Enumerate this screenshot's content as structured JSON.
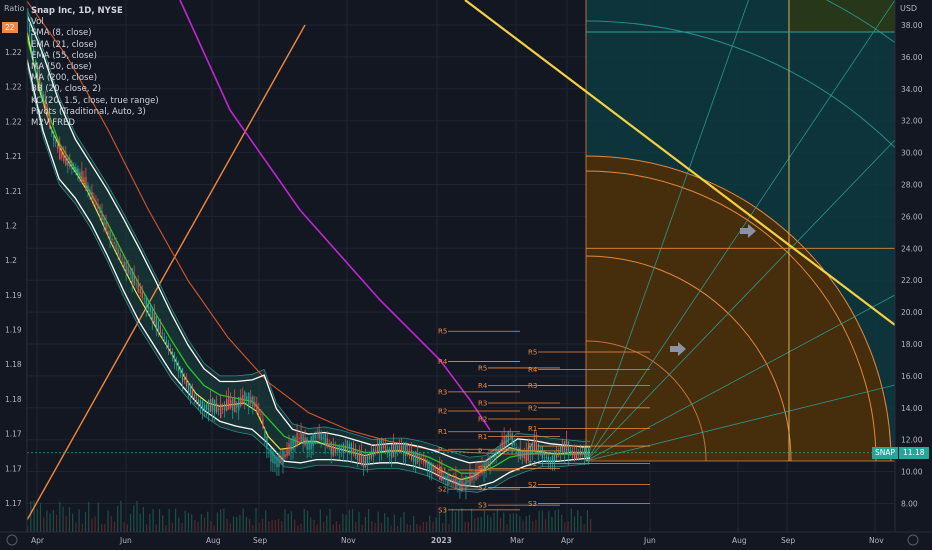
{
  "header": {
    "symbol_line": "Snap Inc, 1D, NYSE",
    "ratio_label": "Ratio",
    "usd_label": "USD",
    "ratio_badge": "22"
  },
  "indicators": [
    "Vol",
    "SMA (8, close)",
    "EMA (21, close)",
    "EMA (55, close)",
    "MA (50, close)",
    "MA (200, close)",
    "BB (20, close, 2)",
    "KC (20, 1.5, close, true range)",
    "Pivots (Traditional, Auto, 3)",
    "M2V FRED"
  ],
  "price_badge": {
    "symbol": "SNAP",
    "value": "11.18",
    "color": "#26a69a"
  },
  "chart_data": {
    "type": "line",
    "x_ticks": [
      "Apr",
      "Jun",
      "Aug",
      "Sep",
      "Nov",
      "2023",
      "Mar",
      "Apr",
      "Jun",
      "Aug",
      "Sep",
      "Nov"
    ],
    "y_right_ticks": [
      "38.00",
      "36.00",
      "34.00",
      "32.00",
      "30.00",
      "28.00",
      "26.00",
      "24.00",
      "22.00",
      "20.00",
      "18.00",
      "16.00",
      "14.00",
      "12.00",
      "10.00",
      "8.00"
    ],
    "y_right_values": [
      38,
      36,
      34,
      32,
      30,
      28,
      26,
      24,
      22,
      20,
      18,
      16,
      14,
      12,
      10,
      8
    ],
    "y_left_ticks": [
      "1.22",
      "1.22",
      "1.22",
      "1.21",
      "1.21",
      "1.2",
      "1.2",
      "1.19",
      "1.19",
      "1.18",
      "1.18",
      "1.17",
      "1.17",
      "1.17"
    ],
    "ylim": [
      6.4,
      39.6
    ],
    "price_path": [
      [
        0,
        38.6
      ],
      [
        4,
        35.5
      ],
      [
        8,
        33.5
      ],
      [
        12,
        31.3
      ],
      [
        16,
        30.0
      ],
      [
        20,
        29.4
      ],
      [
        24,
        29.0
      ],
      [
        28,
        28.3
      ],
      [
        32,
        27.3
      ],
      [
        36,
        26.4
      ],
      [
        40,
        25.0
      ],
      [
        44,
        24.1
      ],
      [
        48,
        23.0
      ],
      [
        52,
        22.3
      ],
      [
        56,
        21.3
      ],
      [
        60,
        20.4
      ],
      [
        64,
        19.4
      ],
      [
        68,
        18.4
      ],
      [
        72,
        17.4
      ],
      [
        76,
        16.3
      ],
      [
        80,
        15.3
      ],
      [
        84,
        14.5
      ],
      [
        88,
        14.0
      ],
      [
        92,
        14.2
      ],
      [
        96,
        13.8
      ],
      [
        100,
        14.3
      ],
      [
        104,
        14.1
      ],
      [
        108,
        14.7
      ],
      [
        112,
        14.4
      ],
      [
        116,
        13.6
      ],
      [
        120,
        11.2
      ],
      [
        124,
        10.6
      ],
      [
        128,
        11.0
      ],
      [
        132,
        11.8
      ],
      [
        136,
        12.2
      ],
      [
        140,
        11.6
      ],
      [
        144,
        12.4
      ],
      [
        148,
        12.0
      ],
      [
        152,
        11.3
      ],
      [
        156,
        11.4
      ],
      [
        160,
        11.6
      ],
      [
        164,
        11.0
      ],
      [
        168,
        10.6
      ],
      [
        172,
        11.2
      ],
      [
        176,
        11.7
      ],
      [
        180,
        11.2
      ],
      [
        184,
        11.5
      ],
      [
        188,
        11.4
      ],
      [
        192,
        10.9
      ],
      [
        196,
        10.8
      ],
      [
        200,
        10.3
      ],
      [
        204,
        10.0
      ],
      [
        208,
        9.6
      ],
      [
        212,
        9.4
      ],
      [
        216,
        9.1
      ],
      [
        220,
        9.5
      ],
      [
        224,
        9.9
      ],
      [
        228,
        10.4
      ],
      [
        232,
        10.9
      ],
      [
        236,
        11.7
      ],
      [
        240,
        12.3
      ],
      [
        244,
        11.2
      ],
      [
        248,
        10.9
      ],
      [
        252,
        11.7
      ],
      [
        256,
        11.2
      ],
      [
        260,
        10.6
      ],
      [
        264,
        11.2
      ],
      [
        268,
        11.6
      ],
      [
        272,
        11.0
      ],
      [
        276,
        11.2
      ],
      [
        280,
        11.18
      ]
    ],
    "ma_fast_path": [
      [
        0,
        37.6
      ],
      [
        6,
        34.0
      ],
      [
        12,
        31.5
      ],
      [
        18,
        29.9
      ],
      [
        24,
        28.8
      ],
      [
        30,
        27.6
      ],
      [
        36,
        26.0
      ],
      [
        42,
        24.3
      ],
      [
        48,
        22.8
      ],
      [
        54,
        21.3
      ],
      [
        60,
        20.0
      ],
      [
        66,
        18.6
      ],
      [
        72,
        17.4
      ],
      [
        78,
        16.0
      ],
      [
        84,
        14.9
      ],
      [
        90,
        14.3
      ],
      [
        96,
        14.1
      ],
      [
        102,
        14.2
      ],
      [
        108,
        14.3
      ],
      [
        114,
        13.8
      ],
      [
        120,
        12.2
      ],
      [
        126,
        11.4
      ],
      [
        132,
        11.5
      ],
      [
        138,
        11.9
      ],
      [
        144,
        11.9
      ],
      [
        150,
        11.6
      ],
      [
        156,
        11.4
      ],
      [
        162,
        11.2
      ],
      [
        168,
        11.0
      ],
      [
        174,
        11.2
      ],
      [
        180,
        11.3
      ],
      [
        186,
        11.3
      ],
      [
        192,
        11.0
      ],
      [
        198,
        10.7
      ],
      [
        204,
        10.2
      ],
      [
        210,
        9.8
      ],
      [
        216,
        9.5
      ],
      [
        222,
        9.7
      ],
      [
        228,
        10.2
      ],
      [
        234,
        10.9
      ],
      [
        240,
        11.5
      ],
      [
        246,
        11.3
      ],
      [
        252,
        11.3
      ],
      [
        258,
        11.2
      ],
      [
        264,
        11.1
      ],
      [
        270,
        11.2
      ],
      [
        276,
        11.2
      ],
      [
        280,
        11.2
      ]
    ],
    "ma_mid_path": [
      [
        0,
        37.2
      ],
      [
        8,
        33.4
      ],
      [
        16,
        30.6
      ],
      [
        24,
        29.0
      ],
      [
        32,
        27.4
      ],
      [
        40,
        25.6
      ],
      [
        48,
        23.6
      ],
      [
        56,
        21.7
      ],
      [
        64,
        19.9
      ],
      [
        72,
        18.2
      ],
      [
        80,
        16.6
      ],
      [
        88,
        15.4
      ],
      [
        96,
        14.8
      ],
      [
        104,
        14.6
      ],
      [
        112,
        14.4
      ],
      [
        120,
        13.3
      ],
      [
        128,
        12.2
      ],
      [
        136,
        11.8
      ],
      [
        144,
        11.8
      ],
      [
        152,
        11.7
      ],
      [
        160,
        11.5
      ],
      [
        168,
        11.2
      ],
      [
        176,
        11.2
      ],
      [
        184,
        11.3
      ],
      [
        192,
        11.2
      ],
      [
        200,
        10.9
      ],
      [
        208,
        10.4
      ],
      [
        216,
        9.9
      ],
      [
        224,
        9.9
      ],
      [
        232,
        10.3
      ],
      [
        240,
        10.9
      ],
      [
        248,
        11.1
      ],
      [
        256,
        11.2
      ],
      [
        264,
        11.1
      ],
      [
        272,
        11.1
      ],
      [
        280,
        11.2
      ]
    ],
    "bb_upper_path": [
      [
        0,
        39.0
      ],
      [
        8,
        36.5
      ],
      [
        16,
        33.5
      ],
      [
        24,
        31.2
      ],
      [
        32,
        29.6
      ],
      [
        40,
        28.0
      ],
      [
        48,
        26.2
      ],
      [
        56,
        24.3
      ],
      [
        64,
        22.3
      ],
      [
        72,
        20.2
      ],
      [
        80,
        18.3
      ],
      [
        88,
        16.8
      ],
      [
        96,
        16.0
      ],
      [
        104,
        16.0
      ],
      [
        112,
        16.1
      ],
      [
        118,
        16.4
      ],
      [
        124,
        14.3
      ],
      [
        132,
        13.0
      ],
      [
        140,
        12.7
      ],
      [
        148,
        12.8
      ],
      [
        156,
        12.6
      ],
      [
        164,
        12.3
      ],
      [
        172,
        12.0
      ],
      [
        180,
        12.1
      ],
      [
        188,
        12.1
      ],
      [
        196,
        11.9
      ],
      [
        204,
        11.6
      ],
      [
        212,
        11.2
      ],
      [
        220,
        10.9
      ],
      [
        228,
        11.0
      ],
      [
        236,
        11.7
      ],
      [
        244,
        12.4
      ],
      [
        252,
        12.3
      ],
      [
        260,
        12.1
      ],
      [
        268,
        12.0
      ],
      [
        276,
        11.9
      ],
      [
        280,
        11.9
      ]
    ],
    "bb_lower_path": [
      [
        0,
        35.5
      ],
      [
        8,
        31.0
      ],
      [
        16,
        28.0
      ],
      [
        24,
        26.8
      ],
      [
        32,
        25.2
      ],
      [
        40,
        23.2
      ],
      [
        48,
        21.0
      ],
      [
        56,
        19.0
      ],
      [
        64,
        17.4
      ],
      [
        72,
        15.8
      ],
      [
        80,
        14.6
      ],
      [
        88,
        13.5
      ],
      [
        96,
        12.8
      ],
      [
        104,
        12.5
      ],
      [
        112,
        12.3
      ],
      [
        120,
        11.4
      ],
      [
        128,
        10.3
      ],
      [
        136,
        10.2
      ],
      [
        144,
        10.4
      ],
      [
        152,
        10.4
      ],
      [
        160,
        10.3
      ],
      [
        168,
        10.1
      ],
      [
        176,
        10.2
      ],
      [
        184,
        10.2
      ],
      [
        192,
        10.0
      ],
      [
        200,
        9.7
      ],
      [
        208,
        9.2
      ],
      [
        216,
        8.8
      ],
      [
        224,
        8.7
      ],
      [
        232,
        9.0
      ],
      [
        240,
        9.6
      ],
      [
        248,
        10.0
      ],
      [
        256,
        10.3
      ],
      [
        264,
        10.3
      ],
      [
        272,
        10.4
      ],
      [
        280,
        10.5
      ]
    ],
    "ma_slow_path": [
      [
        0,
        39.5
      ],
      [
        20,
        36.0
      ],
      [
        40,
        31.5
      ],
      [
        60,
        26.5
      ],
      [
        80,
        22.0
      ],
      [
        100,
        18.4
      ],
      [
        120,
        15.6
      ],
      [
        140,
        13.7
      ],
      [
        160,
        12.6
      ],
      [
        180,
        11.9
      ],
      [
        200,
        11.4
      ],
      [
        220,
        11.2
      ],
      [
        240,
        11.1
      ],
      [
        260,
        11.1
      ],
      [
        280,
        11.1
      ]
    ],
    "pivots": [
      {
        "x": [
          440,
          520
        ],
        "labels": [
          "R5",
          "R4",
          "R3",
          "R2",
          "R1",
          "P",
          "S1",
          "S2",
          "S3"
        ],
        "values": [
          18.8,
          16.9,
          15.0,
          13.8,
          12.5,
          11.4,
          10.1,
          8.9,
          7.6
        ]
      },
      {
        "x": [
          480,
          560
        ],
        "labels": [
          "R5",
          "R4",
          "R3",
          "R2",
          "R1",
          "P",
          "S1",
          "S2",
          "S3"
        ],
        "values": [
          16.5,
          15.4,
          14.3,
          13.3,
          12.2,
          11.3,
          10.2,
          9.0,
          7.9
        ]
      },
      {
        "x": [
          530,
          650
        ],
        "labels": [
          "R5",
          "R4",
          "R3",
          "R2",
          "R1",
          "P",
          "S1",
          "S2",
          "S3"
        ],
        "values": [
          17.5,
          16.4,
          15.4,
          14.0,
          12.7,
          11.6,
          10.5,
          9.2,
          8.0
        ]
      }
    ]
  }
}
